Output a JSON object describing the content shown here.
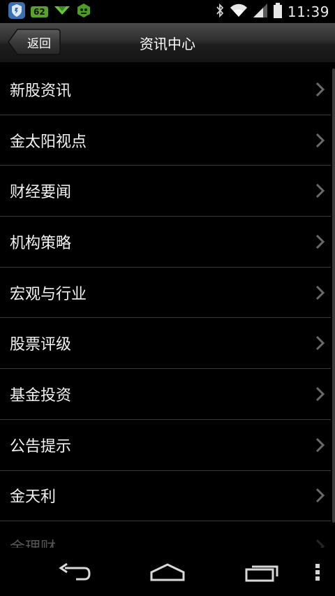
{
  "status_bar": {
    "icons_left": [
      "shield-icon",
      "battery-badge-icon",
      "download-icon",
      "robot-icon"
    ],
    "badge_text": "62",
    "icons_right": [
      "bluetooth-icon",
      "wifi-icon",
      "signal-icon",
      "battery-icon"
    ],
    "time": "11:39"
  },
  "header": {
    "back_label": "返回",
    "title": "资讯中心"
  },
  "menu": {
    "items": [
      {
        "label": "新股资讯"
      },
      {
        "label": "金太阳视点"
      },
      {
        "label": "财经要闻"
      },
      {
        "label": "机构策略"
      },
      {
        "label": "宏观与行业"
      },
      {
        "label": "股票评级"
      },
      {
        "label": "基金投资"
      },
      {
        "label": "公告提示"
      },
      {
        "label": "金天利"
      },
      {
        "label": "金理财"
      }
    ]
  },
  "nav_bar": {
    "buttons": [
      "back-icon",
      "home-icon",
      "recent-apps-icon",
      "overflow-menu-icon"
    ]
  },
  "colors": {
    "background": "#000000",
    "divider": "#3a3a3a",
    "badge": "#5aa02c"
  }
}
